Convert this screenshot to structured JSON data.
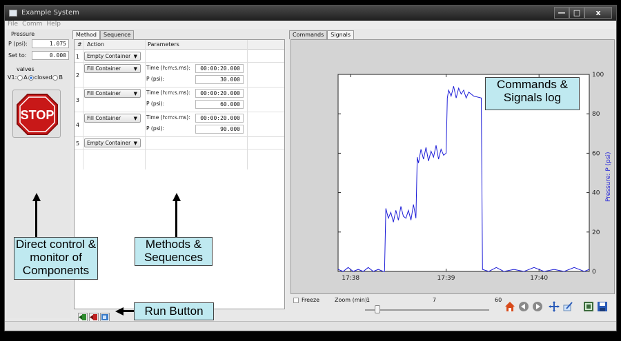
{
  "window": {
    "title": "Example System",
    "min": "—",
    "max": "□",
    "close": "x"
  },
  "menu": [
    "File",
    "Comm",
    "Help"
  ],
  "left": {
    "pressure_heading": "Pressure",
    "p_label": "P (psi):",
    "p_value": "1.075",
    "set_label": "Set to:",
    "set_value": "0.000",
    "valves_heading": "valves",
    "v1_label": "V1:",
    "opt_a": "A",
    "opt_closed": "closed",
    "opt_b": "B",
    "selected": "closed",
    "stop_label": "STOP"
  },
  "method": {
    "tabs": [
      "Method",
      "Sequence"
    ],
    "headers": {
      "num": "#",
      "action": "Action",
      "params": "Parameters"
    },
    "rows": [
      {
        "num": "1",
        "action": "Empty Container"
      },
      {
        "num": "2",
        "action": "Fill Container",
        "time_label": "Time (h:m:s.ms):",
        "time": "00:00:20.000",
        "p_label": "P (psi):",
        "p": "30.000"
      },
      {
        "num": "3",
        "action": "Fill Container",
        "time_label": "Time (h:m:s.ms):",
        "time": "00:00:20.000",
        "p_label": "P (psi):",
        "p": "60.000"
      },
      {
        "num": "4",
        "action": "Fill Container",
        "time_label": "Time (h:m:s.ms):",
        "time": "00:00:20.000",
        "p_label": "P (psi):",
        "p": "90.000"
      },
      {
        "num": "5",
        "action": "Empty Container"
      }
    ]
  },
  "signals": {
    "tabs": [
      "Commands",
      "Signals"
    ],
    "freeze_label": "Freeze",
    "zoom_label": "Zoom (min):",
    "zoom_min": "1",
    "zoom_value": "7",
    "zoom_max": "60",
    "zoom_level": 0.1
  },
  "chart_data": {
    "type": "line",
    "title": "",
    "xlabel": "",
    "ylabel": "Pressure: P (psi)",
    "x_ticks": [
      "17:38",
      "17:39",
      "17:40"
    ],
    "y_ticks": [
      "0",
      "20",
      "40",
      "60",
      "80",
      "100"
    ],
    "ylim": [
      0,
      100
    ],
    "xlim": [
      0,
      1
    ],
    "series": [
      {
        "color": "#1f1fd8",
        "points": [
          [
            0.0,
            1
          ],
          [
            0.02,
            0
          ],
          [
            0.04,
            2
          ],
          [
            0.06,
            0
          ],
          [
            0.08,
            1
          ],
          [
            0.1,
            0
          ],
          [
            0.12,
            2
          ],
          [
            0.14,
            0
          ],
          [
            0.16,
            1
          ],
          [
            0.18,
            0
          ],
          [
            0.185,
            0
          ],
          [
            0.19,
            32
          ],
          [
            0.2,
            27
          ],
          [
            0.21,
            30
          ],
          [
            0.22,
            25
          ],
          [
            0.23,
            31
          ],
          [
            0.24,
            26
          ],
          [
            0.25,
            33
          ],
          [
            0.26,
            28
          ],
          [
            0.27,
            27
          ],
          [
            0.28,
            31
          ],
          [
            0.29,
            26
          ],
          [
            0.3,
            34
          ],
          [
            0.31,
            27
          ],
          [
            0.315,
            58
          ],
          [
            0.32,
            55
          ],
          [
            0.33,
            62
          ],
          [
            0.34,
            57
          ],
          [
            0.35,
            63
          ],
          [
            0.36,
            56
          ],
          [
            0.37,
            61
          ],
          [
            0.38,
            58
          ],
          [
            0.39,
            64
          ],
          [
            0.4,
            57
          ],
          [
            0.41,
            62
          ],
          [
            0.42,
            59
          ],
          [
            0.43,
            60
          ],
          [
            0.435,
            88
          ],
          [
            0.44,
            92
          ],
          [
            0.45,
            89
          ],
          [
            0.46,
            94
          ],
          [
            0.47,
            88
          ],
          [
            0.48,
            93
          ],
          [
            0.49,
            90
          ],
          [
            0.5,
            92
          ],
          [
            0.51,
            88
          ],
          [
            0.52,
            91
          ],
          [
            0.54,
            89
          ],
          [
            0.57,
            88
          ],
          [
            0.575,
            1
          ],
          [
            0.6,
            0
          ],
          [
            0.63,
            2
          ],
          [
            0.66,
            0
          ],
          [
            0.7,
            1
          ],
          [
            0.74,
            0
          ],
          [
            0.78,
            2
          ],
          [
            0.82,
            0
          ],
          [
            0.86,
            1
          ],
          [
            0.9,
            0
          ],
          [
            0.94,
            2
          ],
          [
            0.98,
            0
          ],
          [
            1.0,
            1
          ]
        ]
      }
    ]
  },
  "annotations": {
    "direct_control": "Direct control & monitor of Components",
    "methods": "Methods & Sequences",
    "commands_log": "Commands & Signals log",
    "run_button": "Run Button"
  }
}
